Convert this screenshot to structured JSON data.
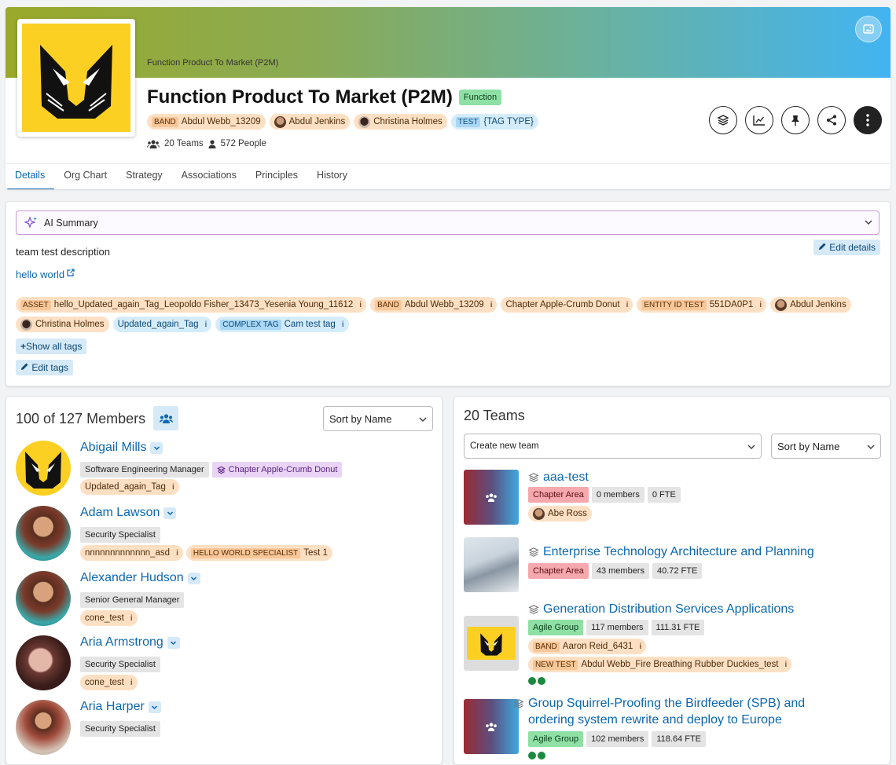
{
  "header": {
    "breadcrumb": "Function Product To Market (P2M)",
    "title": "Function Product To Market (P2M)",
    "type_badge": "Function",
    "tags": [
      {
        "key": "BAND",
        "value": "Abdul Webb_13209"
      },
      {
        "value": "Abdul Jenkins"
      },
      {
        "value": "Christina Holmes"
      },
      {
        "key": "TEST",
        "value": "{TAG TYPE}"
      }
    ],
    "teams_count": "20 Teams",
    "people_count": "572 People"
  },
  "tabs": [
    "Details",
    "Org Chart",
    "Strategy",
    "Associations",
    "Principles",
    "History"
  ],
  "details": {
    "ai_summary": "AI Summary",
    "description": "team test description",
    "link": "hello world",
    "edit_details": "Edit details",
    "tags_row1": [
      {
        "key": "ASSET",
        "value": "hello_Updated_again_Tag_Leopoldo Fisher_13473_Yesenia Young_11612",
        "color": "orange"
      },
      {
        "key": "BAND",
        "value": "Abdul Webb_13209",
        "color": "orange"
      },
      {
        "value": "Chapter Apple-Crumb Donut",
        "color": "orange"
      },
      {
        "key": "ENTITY ID TEST",
        "value": "551DA0P1",
        "color": "orange"
      },
      {
        "value": "Abdul Jenkins",
        "color": "orange"
      }
    ],
    "tags_row2": [
      {
        "value": "Christina Holmes",
        "color": "orange"
      },
      {
        "value": "Updated_again_Tag",
        "color": "blue"
      },
      {
        "key": "COMPLEX TAG",
        "value": "Cam test tag",
        "color": "blue"
      }
    ],
    "show_all_tags": "Show all tags",
    "edit_tags": "Edit tags"
  },
  "members": {
    "title": "100 of 127 Members",
    "sort": "Sort by Name",
    "list": [
      {
        "name": "Abigail Mills",
        "role": "Software Engineering Manager",
        "chapter": "Chapter Apple-Crumb Donut",
        "tags": [
          "Updated_again_Tag"
        ]
      },
      {
        "name": "Adam Lawson",
        "role": "Security Specialist",
        "tags": [
          "nnnnnnnnnnnnn_asd"
        ],
        "key_tag": {
          "key": "HELLO WORLD SPECIALIST",
          "value": "Test 1"
        }
      },
      {
        "name": "Alexander Hudson",
        "role": "Senior General Manager",
        "tags": [
          "cone_test"
        ]
      },
      {
        "name": "Aria Armstrong",
        "role": "Security Specialist",
        "tags": [
          "cone_test"
        ]
      },
      {
        "name": "Aria Harper",
        "role": "Security Specialist",
        "tags": []
      }
    ]
  },
  "teams": {
    "title": "20 Teams",
    "create_placeholder": "Create new team",
    "sort": "Sort by Name",
    "list": [
      {
        "name": "aaa-test",
        "type": "Chapter Area",
        "members": "0 members",
        "fte": "0 FTE",
        "person": "Abe Ross"
      },
      {
        "name": "Enterprise Technology Architecture and Planning",
        "type": "Chapter Area",
        "members": "43 members",
        "fte": "40.72 FTE"
      },
      {
        "name": "Generation Distribution Services Applications",
        "type": "Agile Group",
        "members": "117 members",
        "fte": "111.31 FTE",
        "tag1": {
          "key": "BAND",
          "value": "Aaron Reid_6431"
        },
        "tag2": {
          "key": "NEW TEST",
          "value": "Abdul Webb_Fire Breathing Rubber Duckies_test"
        }
      },
      {
        "name_line1": "Group Squirrel-Proofing the Birdfeeder (SPB) and",
        "name_line2": "ordering system rewrite and deploy to Europe",
        "type": "Agile Group",
        "members": "102 members",
        "fte": "118.64 FTE"
      }
    ]
  }
}
